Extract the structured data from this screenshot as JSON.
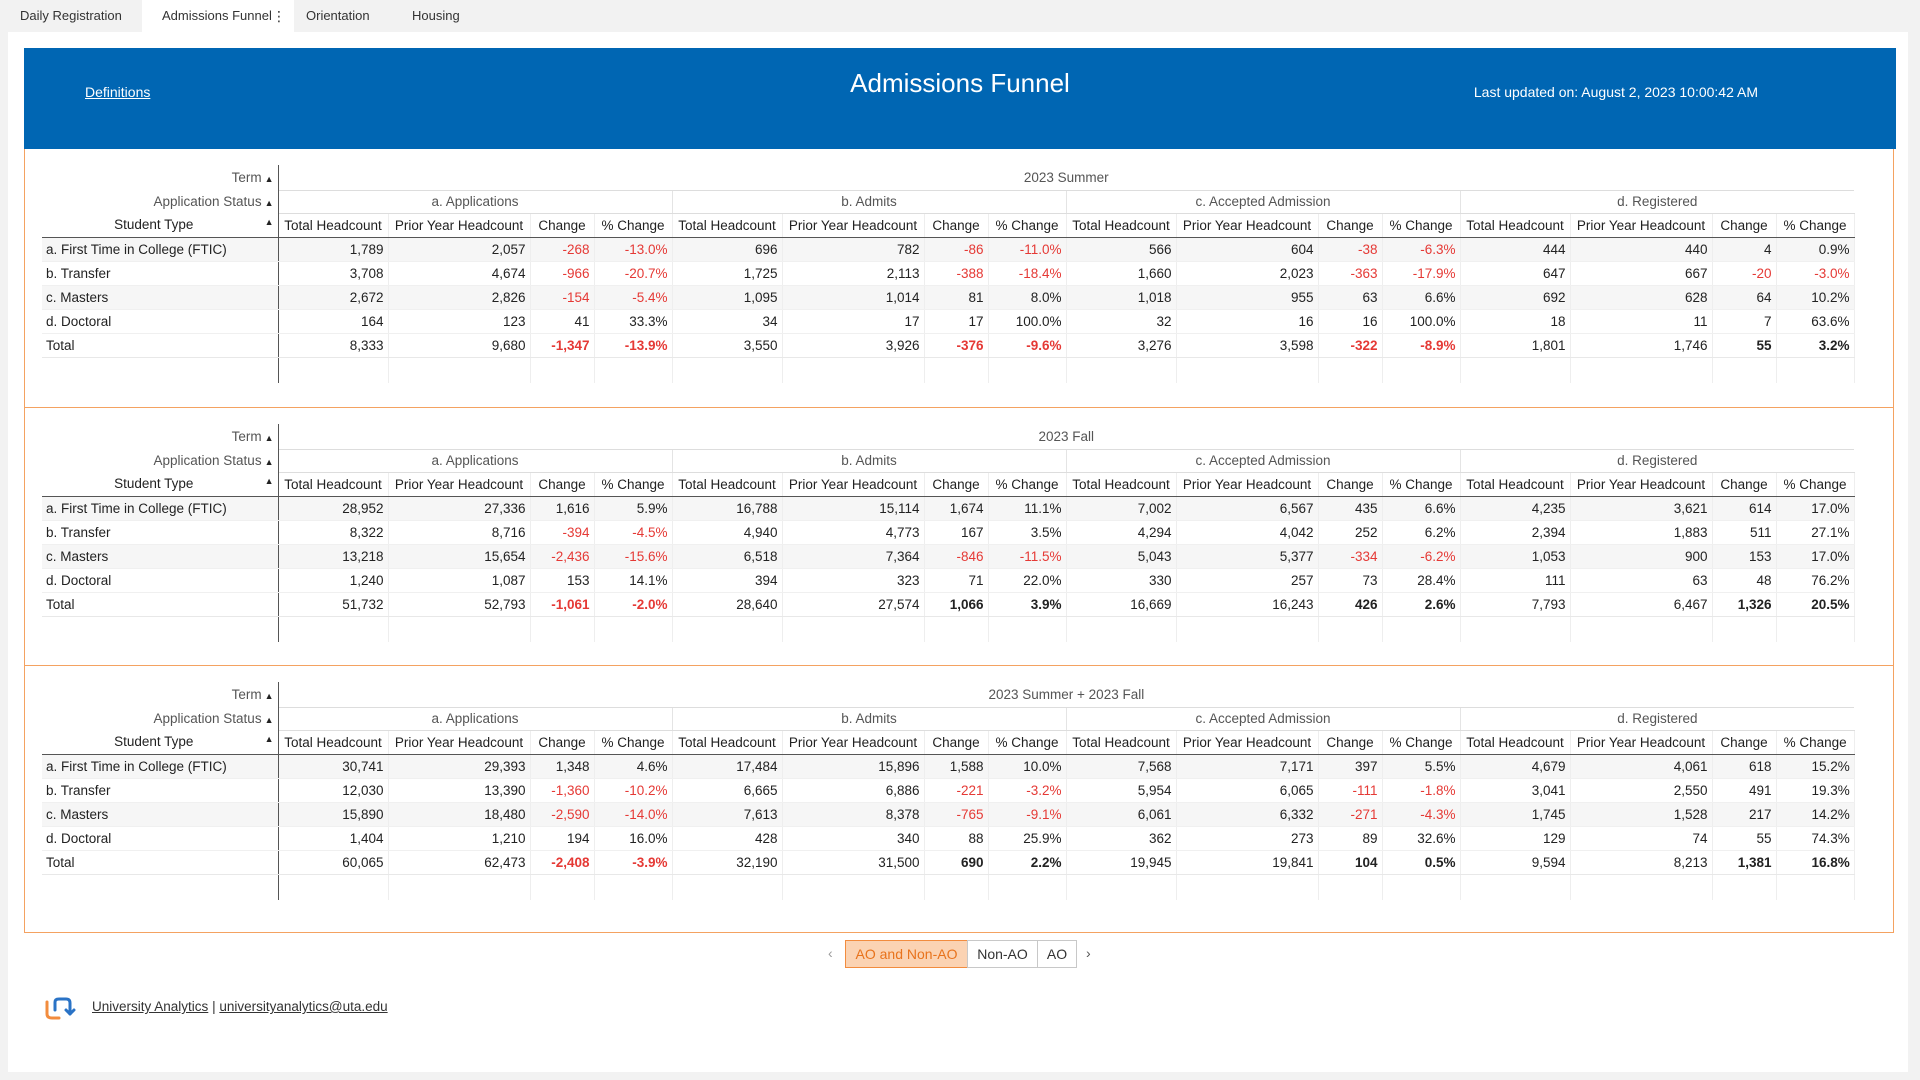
{
  "tabs": [
    "Daily Registration",
    "Admissions Funnel",
    "Orientation",
    "Housing"
  ],
  "tab_more_icon": "⋮",
  "banner": {
    "definitions_link": "Definitions",
    "title": "Admissions Funnel",
    "last_updated": "Last updated on: August 2, 2023 10:00:42 AM"
  },
  "header_labels": {
    "term": "Term",
    "application_status": "Application Status",
    "student_type": "Student Type",
    "groups": [
      "a. Applications",
      "b. Admits",
      "c. Accepted Admission",
      "d. Registered"
    ],
    "columns": [
      "Total Headcount",
      "Prior Year Headcount",
      "Change",
      "% Change"
    ]
  },
  "tables": [
    {
      "term": "2023 Summer",
      "rows": [
        {
          "type": "a. First Time in College (FTIC)",
          "values": [
            "1,789",
            "2,057",
            "-268",
            "-13.0%",
            "696",
            "782",
            "-86",
            "-11.0%",
            "566",
            "604",
            "-38",
            "-6.3%",
            "444",
            "440",
            "4",
            "0.9%"
          ]
        },
        {
          "type": "b. Transfer",
          "values": [
            "3,708",
            "4,674",
            "-966",
            "-20.7%",
            "1,725",
            "2,113",
            "-388",
            "-18.4%",
            "1,660",
            "2,023",
            "-363",
            "-17.9%",
            "647",
            "667",
            "-20",
            "-3.0%"
          ]
        },
        {
          "type": "c. Masters",
          "values": [
            "2,672",
            "2,826",
            "-154",
            "-5.4%",
            "1,095",
            "1,014",
            "81",
            "8.0%",
            "1,018",
            "955",
            "63",
            "6.6%",
            "692",
            "628",
            "64",
            "10.2%"
          ]
        },
        {
          "type": "d. Doctoral",
          "values": [
            "164",
            "123",
            "41",
            "33.3%",
            "34",
            "17",
            "17",
            "100.0%",
            "32",
            "16",
            "16",
            "100.0%",
            "18",
            "11",
            "7",
            "63.6%"
          ]
        },
        {
          "type": "Total",
          "values": [
            "8,333",
            "9,680",
            "-1,347",
            "-13.9%",
            "3,550",
            "3,926",
            "-376",
            "-9.6%",
            "3,276",
            "3,598",
            "-322",
            "-8.9%",
            "1,801",
            "1,746",
            "55",
            "3.2%"
          ]
        }
      ]
    },
    {
      "term": "2023 Fall",
      "rows": [
        {
          "type": "a. First Time in College (FTIC)",
          "values": [
            "28,952",
            "27,336",
            "1,616",
            "5.9%",
            "16,788",
            "15,114",
            "1,674",
            "11.1%",
            "7,002",
            "6,567",
            "435",
            "6.6%",
            "4,235",
            "3,621",
            "614",
            "17.0%"
          ]
        },
        {
          "type": "b. Transfer",
          "values": [
            "8,322",
            "8,716",
            "-394",
            "-4.5%",
            "4,940",
            "4,773",
            "167",
            "3.5%",
            "4,294",
            "4,042",
            "252",
            "6.2%",
            "2,394",
            "1,883",
            "511",
            "27.1%"
          ]
        },
        {
          "type": "c. Masters",
          "values": [
            "13,218",
            "15,654",
            "-2,436",
            "-15.6%",
            "6,518",
            "7,364",
            "-846",
            "-11.5%",
            "5,043",
            "5,377",
            "-334",
            "-6.2%",
            "1,053",
            "900",
            "153",
            "17.0%"
          ]
        },
        {
          "type": "d. Doctoral",
          "values": [
            "1,240",
            "1,087",
            "153",
            "14.1%",
            "394",
            "323",
            "71",
            "22.0%",
            "330",
            "257",
            "73",
            "28.4%",
            "111",
            "63",
            "48",
            "76.2%"
          ]
        },
        {
          "type": "Total",
          "values": [
            "51,732",
            "52,793",
            "-1,061",
            "-2.0%",
            "28,640",
            "27,574",
            "1,066",
            "3.9%",
            "16,669",
            "16,243",
            "426",
            "2.6%",
            "7,793",
            "6,467",
            "1,326",
            "20.5%"
          ]
        }
      ]
    },
    {
      "term": "2023 Summer + 2023 Fall",
      "rows": [
        {
          "type": "a. First Time in College (FTIC)",
          "values": [
            "30,741",
            "29,393",
            "1,348",
            "4.6%",
            "17,484",
            "15,896",
            "1,588",
            "10.0%",
            "7,568",
            "7,171",
            "397",
            "5.5%",
            "4,679",
            "4,061",
            "618",
            "15.2%"
          ]
        },
        {
          "type": "b. Transfer",
          "values": [
            "12,030",
            "13,390",
            "-1,360",
            "-10.2%",
            "6,665",
            "6,886",
            "-221",
            "-3.2%",
            "5,954",
            "6,065",
            "-111",
            "-1.8%",
            "3,041",
            "2,550",
            "491",
            "19.3%"
          ]
        },
        {
          "type": "c. Masters",
          "values": [
            "15,890",
            "18,480",
            "-2,590",
            "-14.0%",
            "7,613",
            "8,378",
            "-765",
            "-9.1%",
            "6,061",
            "6,332",
            "-271",
            "-4.3%",
            "1,745",
            "1,528",
            "217",
            "14.2%"
          ]
        },
        {
          "type": "d. Doctoral",
          "values": [
            "1,404",
            "1,210",
            "194",
            "16.0%",
            "428",
            "340",
            "88",
            "25.9%",
            "362",
            "273",
            "89",
            "32.6%",
            "129",
            "74",
            "55",
            "74.3%"
          ]
        },
        {
          "type": "Total",
          "values": [
            "60,065",
            "62,473",
            "-2,408",
            "-3.9%",
            "32,190",
            "31,500",
            "690",
            "2.2%",
            "19,945",
            "19,841",
            "104",
            "0.5%",
            "9,594",
            "8,213",
            "1,381",
            "16.8%"
          ]
        }
      ]
    }
  ],
  "pager": {
    "prev_icon": "‹",
    "next_icon": "›",
    "buttons": [
      "AO and Non-AO",
      "Non-AO",
      "AO"
    ],
    "selected": 0
  },
  "footer": {
    "org_link": "University Analytics",
    "separator": "|",
    "email_link": "universityanalytics@uta.edu"
  },
  "colors": {
    "banner": "#0066b3",
    "panel_border": "#f4a261",
    "negative": "#e53935",
    "pager_selected_bg": "#fbd3b3",
    "pager_selected_text": "#e8731c"
  }
}
